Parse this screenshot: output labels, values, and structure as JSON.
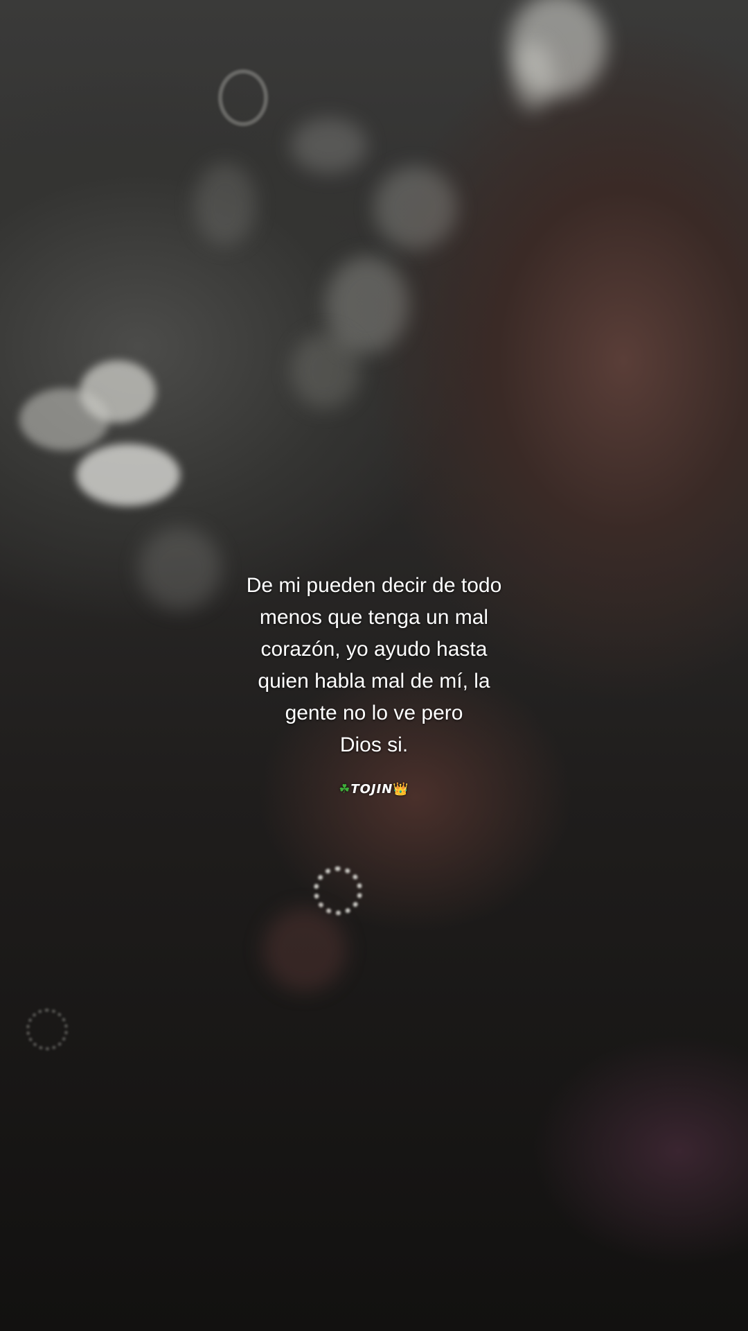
{
  "caption": {
    "lines": [
      "De mi pueden decir de todo",
      "menos que tenga un mal",
      "corazón, yo ayudo hasta",
      "quien habla mal de mí, la",
      "gente no lo ve pero",
      "Dios si."
    ]
  },
  "signature": {
    "clover": "☘",
    "name": "TOJIN",
    "crown": "👑"
  }
}
